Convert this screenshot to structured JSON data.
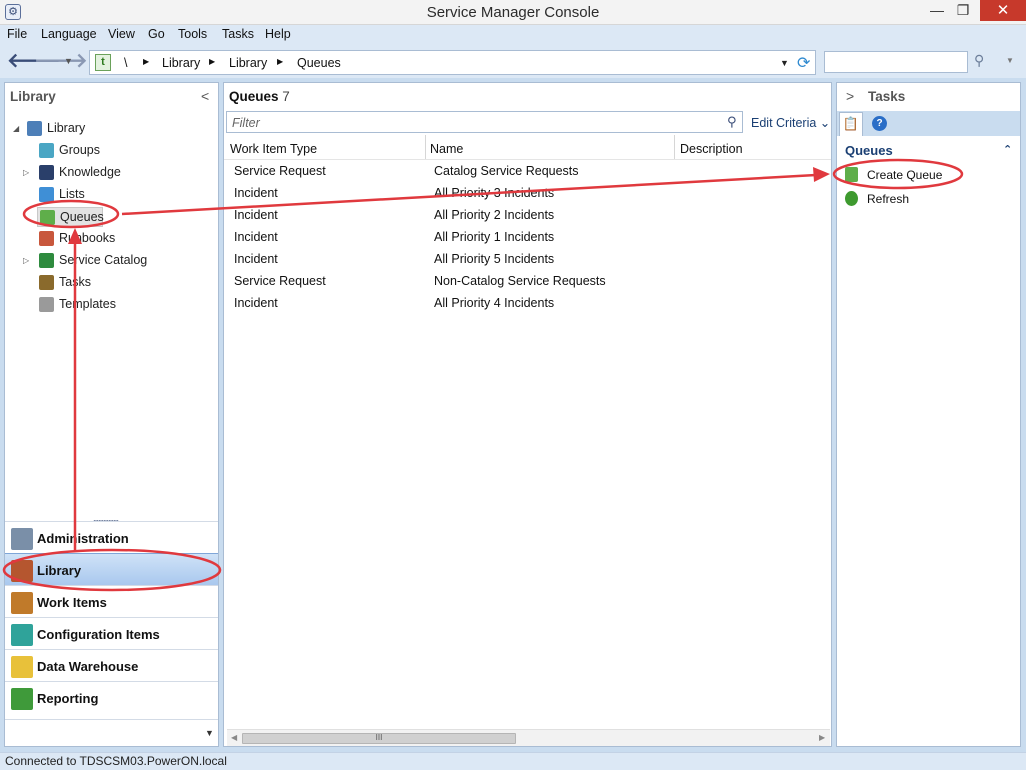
{
  "window": {
    "title": "Service Manager Console",
    "minimize": "—",
    "maximize": "❐",
    "close": "✕",
    "app_icon": "⚙"
  },
  "menu": [
    "File",
    "Language",
    "View",
    "Go",
    "Tools",
    "Tasks",
    "Help"
  ],
  "address": {
    "back": "🡐",
    "forward": "🡒",
    "history_drop": "▼",
    "breadcrumb": [
      "\\",
      "Library",
      "Library",
      "Queues"
    ],
    "separator": "▶",
    "dropdown": "▼",
    "refresh": "⟳",
    "search_value": "",
    "search_icon": "⚲",
    "search_drop": "▼"
  },
  "left": {
    "title": "Library",
    "collapse": "<",
    "tree": [
      {
        "label": "Library",
        "arrow": "◢",
        "icon_color": "#4d7fb8"
      },
      {
        "label": "Groups",
        "arrow": "",
        "icon_color": "#4aa6c4"
      },
      {
        "label": "Knowledge",
        "arrow": "▷",
        "icon_color": "#2a3f6a"
      },
      {
        "label": "Lists",
        "arrow": "",
        "icon_color": "#3f8fd6"
      },
      {
        "label": "Queues",
        "arrow": "",
        "icon_color": "#5fae4a"
      },
      {
        "label": "Runbooks",
        "arrow": "",
        "icon_color": "#c8573c"
      },
      {
        "label": "Service Catalog",
        "arrow": "▷",
        "icon_color": "#2e8b3e"
      },
      {
        "label": "Tasks",
        "arrow": "",
        "icon_color": "#8a6a2c"
      },
      {
        "label": "Templates",
        "arrow": "",
        "icon_color": "#9a9a9a"
      }
    ],
    "grip": "••••••••••",
    "wunderbar": [
      {
        "label": "Administration",
        "icon_color": "#7a8fa8"
      },
      {
        "label": "Library",
        "icon_color": "#b5562f"
      },
      {
        "label": "Work Items",
        "icon_color": "#c07a2a"
      },
      {
        "label": "Configuration Items",
        "icon_color": "#2fa39a"
      },
      {
        "label": "Data Warehouse",
        "icon_color": "#e8c13a"
      },
      {
        "label": "Reporting",
        "icon_color": "#3f9a3a"
      }
    ],
    "more": "▼"
  },
  "center": {
    "title": "Queues",
    "count": "7",
    "filter_placeholder": "Filter",
    "filter_icon": "⚲",
    "edit_criteria": "Edit Criteria ⌄",
    "columns": [
      "Work Item Type",
      "Name",
      "Description"
    ],
    "rows": [
      [
        "Service Request",
        "Catalog Service Requests",
        ""
      ],
      [
        "Incident",
        "All Priority 3 Incidents",
        ""
      ],
      [
        "Incident",
        "All Priority 2 Incidents",
        ""
      ],
      [
        "Incident",
        "All Priority 1 Incidents",
        ""
      ],
      [
        "Incident",
        "All Priority 5 Incidents",
        ""
      ],
      [
        "Service Request",
        "Non-Catalog Service Requests",
        ""
      ],
      [
        "Incident",
        "All Priority 4 Incidents",
        ""
      ]
    ],
    "scroll_left": "◀",
    "scroll_right": "▶",
    "scroll_grip": "III"
  },
  "right": {
    "expand": ">",
    "title": "Tasks",
    "tab_task_icon": "📋",
    "tab_help_icon": "?",
    "section": "Queues",
    "section_chevron": "⌃",
    "tasks": [
      {
        "label": "Create Queue",
        "icon_color": "#5fae4a"
      },
      {
        "label": "Refresh",
        "icon_color": "#3e9a2f"
      }
    ]
  },
  "status": "Connected to TDSCSM03.PowerON.local",
  "annotation_color": "#e0393e"
}
